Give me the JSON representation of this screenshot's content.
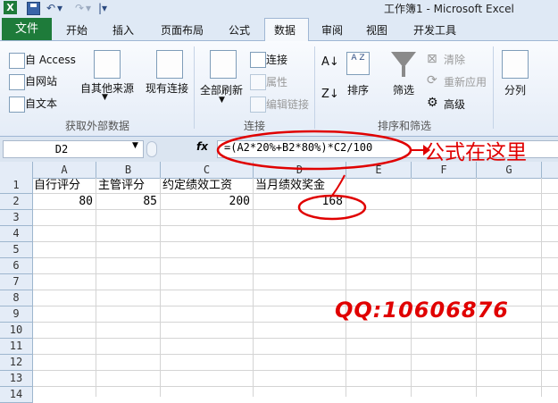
{
  "window": {
    "title": "工作簿1 - Microsoft Excel"
  },
  "tabs": [
    "文件",
    "开始",
    "插入",
    "页面布局",
    "公式",
    "数据",
    "审阅",
    "视图",
    "开发工具"
  ],
  "active_tab": "数据",
  "ribbon": {
    "access": "自 Access",
    "web": "自网站",
    "text": "自文本",
    "other_sources": "自其他来源",
    "existing": "现有连接",
    "refresh_all": "全部刷新",
    "connections": "连接",
    "properties": "属性",
    "edit_links": "编辑链接",
    "sort": "排序",
    "filter": "筛选",
    "clear": "清除",
    "reapply": "重新应用",
    "advanced": "高级",
    "split": "分列",
    "group_external": "获取外部数据",
    "group_connections": "连接",
    "group_sort": "排序和筛选"
  },
  "formula_bar": {
    "name_box": "D2",
    "fx": "fx",
    "formula": "=(A2*20%+B2*80%)*C2/100"
  },
  "columns": [
    "A",
    "B",
    "C",
    "D",
    "E",
    "F",
    "G"
  ],
  "rows": [
    "1",
    "2",
    "3",
    "4",
    "5",
    "6",
    "7",
    "8",
    "9",
    "10",
    "11",
    "12",
    "13",
    "14"
  ],
  "cells": {
    "A1": "自行评分",
    "B1": "主管评分",
    "C1": "约定绩效工资",
    "D1": "当月绩效奖金",
    "A2": "80",
    "B2": "85",
    "C2": "200",
    "D2": "168"
  },
  "annotations": {
    "callout": "公式在这里",
    "qq": "QQ:10606876",
    "color": "#e00000"
  },
  "colors": {
    "file_tab": "#1e7b3a",
    "ribbon_bg": "#e4ecf7"
  }
}
